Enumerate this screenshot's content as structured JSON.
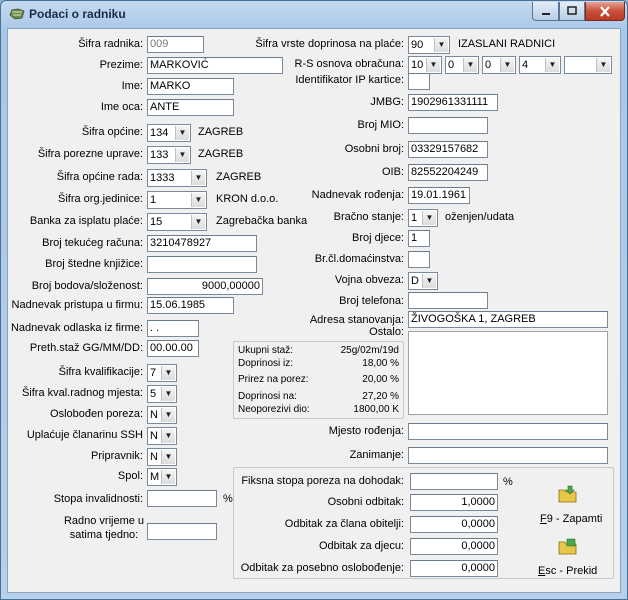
{
  "window": {
    "title": "Podaci o radniku"
  },
  "left": {
    "sifra_radnika": {
      "label": "Šifra radnika:",
      "value": "009"
    },
    "prezime": {
      "label": "Prezime:",
      "value": "MARKOVIĆ"
    },
    "ime": {
      "label": "Ime:",
      "value": "MARKO"
    },
    "ime_oca": {
      "label": "Ime oca:",
      "value": "ANTE"
    },
    "sifra_opcine": {
      "label": "Šifra općine:",
      "value": "134",
      "text": "ZAGREB"
    },
    "sifra_porezne": {
      "label": "Šifra porezne uprave:",
      "value": "133",
      "text": "ZAGREB"
    },
    "sifra_opcine_rada": {
      "label": "Šifra općine rada:",
      "value": "1333",
      "text": "ZAGREB"
    },
    "sifra_org": {
      "label": "Šifra org.jedinice:",
      "value": "1",
      "text": "KRON d.o.o."
    },
    "banka": {
      "label": "Banka za isplatu plaće:",
      "value": "15",
      "text": "Zagrebačka banka"
    },
    "broj_racuna": {
      "label": "Broj tekućeg računa:",
      "value": "3210478927"
    },
    "broj_knjizice": {
      "label": "Broj štedne knjižice:",
      "value": ""
    },
    "bodovi": {
      "label": "Broj bodova/složenost:",
      "value": "9000,00000"
    },
    "pristup": {
      "label": "Nadnevak pristupa u firmu:",
      "value": "15.06.1985"
    },
    "odlazak": {
      "label": "Nadnevak odlaska iz firme:",
      "value": "  .  ."
    },
    "preth_staz": {
      "label": "Preth.staž GG/MM/DD:",
      "value": "00.00.00"
    },
    "kvalifikacija": {
      "label": "Šifra kvalifikacije:",
      "value": "7"
    },
    "kval_mjesta": {
      "label": "Šifra kval.radnog mjesta:",
      "value": "5"
    },
    "oslobodjen": {
      "label": "Oslobođen poreza:",
      "value": "N"
    },
    "ssh": {
      "label": "Uplaćuje članarinu SSH",
      "value": "N"
    },
    "pripravnik": {
      "label": "Pripravnik:",
      "value": "N"
    },
    "spol": {
      "label": "Spol:",
      "value": "M"
    },
    "invalidnost": {
      "label": "Stopa invalidnosti:",
      "value": "",
      "unit": "%"
    },
    "radno_vrijeme": {
      "label1": "Radno vrijeme u",
      "label2": "satima tjedno:",
      "value": ""
    }
  },
  "right": {
    "doprinos": {
      "label": "Šifra vrste doprinosa na plaće:",
      "value": "90",
      "text": "IZASLANI RADNICI"
    },
    "rs_osnova": {
      "label": "R-S osnova obračuna:",
      "v1": "10",
      "v2": "0",
      "v3": "0",
      "v4": "4",
      "v5": ""
    },
    "ip_kartice": {
      "label": "Identifikator IP kartice:",
      "value": ""
    },
    "jmbg": {
      "label": "JMBG:",
      "value": "1902961331111"
    },
    "mio": {
      "label": "Broj MIO:",
      "value": ""
    },
    "osobni_broj": {
      "label": "Osobni broj:",
      "value": "03329157682"
    },
    "oib": {
      "label": "OIB:",
      "value": "82552204249"
    },
    "rodjenje": {
      "label": "Nadnevak rođenja:",
      "value": "19.01.1961"
    },
    "bracno": {
      "label": "Bračno stanje:",
      "value": "1",
      "text": "oženjen/udata"
    },
    "djeca": {
      "label": "Broj djece:",
      "value": "1"
    },
    "clanovi": {
      "label": "Br.čl.domaćinstva:",
      "value": ""
    },
    "vojna": {
      "label": "Vojna obveza:",
      "value": "D"
    },
    "telefon": {
      "label": "Broj telefona:",
      "value": ""
    },
    "adresa": {
      "label": "Adresa stanovanja:",
      "value": "ŽIVOGOŠKA 1, ZAGREB"
    },
    "ostalo": {
      "label": "Ostalo:",
      "value": ""
    },
    "mjesto_rodjenja": {
      "label": "Mjesto rođenja:",
      "value": ""
    },
    "zanimanje": {
      "label": "Zanimanje:",
      "value": ""
    }
  },
  "summary": [
    {
      "label": "Ukupni staž:",
      "value": "25g/02m/19d"
    },
    {
      "label": "Doprinosi iz:",
      "value": "18,00 %"
    },
    {
      "label": "Prirez na porez:",
      "value": "20,00 %"
    },
    {
      "label": "Doprinosi na:",
      "value": "27,20 %"
    },
    {
      "label": "Neoporezivi dio:",
      "value": "1800,00 K"
    }
  ],
  "tax": {
    "fiksna": {
      "label": "Fiksna stopa poreza na dohodak:",
      "value": "",
      "unit": "%"
    },
    "osobni": {
      "label": "Osobni odbitak:",
      "value": "1,0000"
    },
    "clanovi": {
      "label": "Odbitak za člana obitelji:",
      "value": "0,0000"
    },
    "djeca": {
      "label": "Odbitak za djecu:",
      "value": "0,0000"
    },
    "posebno": {
      "label": "Odbitak za posebno oslobođenje:",
      "value": "0,0000"
    }
  },
  "actions": {
    "save": {
      "key": "F",
      "label": "9 - Zapamti"
    },
    "cancel": {
      "key": "E",
      "label": "sc - Prekid"
    }
  },
  "colors": {
    "title_gradient_top": "#c4dbf1",
    "close": "#c9503b",
    "client_bg": "#f0f0f0"
  }
}
